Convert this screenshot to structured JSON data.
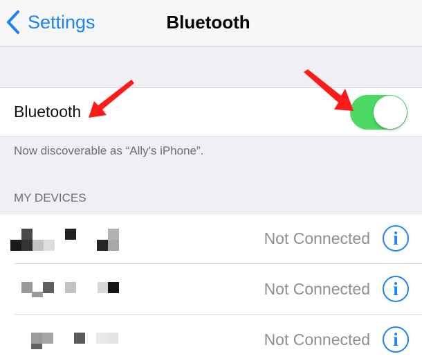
{
  "navbar": {
    "back_label": "Settings",
    "title": "Bluetooth"
  },
  "bluetooth": {
    "label": "Bluetooth",
    "toggle_on": true,
    "toggle_color": "#4cd964",
    "footnote": "Now discoverable as “Ally's iPhone”."
  },
  "my_devices": {
    "header": "MY DEVICES",
    "devices": [
      {
        "name": "[pixelated]",
        "status": "Not Connected",
        "info_icon": "info-icon"
      },
      {
        "name": "[pixelated]",
        "status": "Not Connected",
        "info_icon": "info-icon"
      },
      {
        "name": "[pixelated]",
        "status": "Not Connected",
        "info_icon": "info-icon"
      }
    ]
  },
  "annotations": {
    "arrow_color": "#ff1a1a",
    "arrows": [
      "arrow-to-bluetooth-label",
      "arrow-to-bluetooth-toggle"
    ]
  },
  "colors": {
    "accent": "#1a82fb",
    "background": "#efeff4",
    "secondary_text": "#8e8e93"
  }
}
